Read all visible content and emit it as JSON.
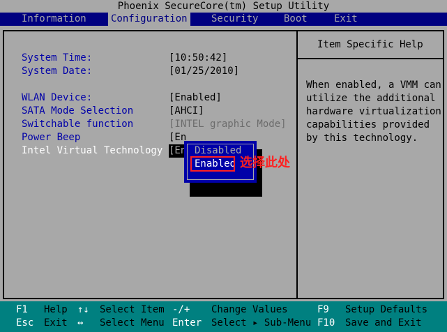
{
  "window": {
    "title": "Phoenix SecureCore(tm) Setup Utility"
  },
  "menu": {
    "items": [
      "Information",
      "Configuration",
      "Security",
      "Boot",
      "Exit"
    ],
    "active": "Configuration"
  },
  "settings": {
    "system_time": {
      "label": "System Time:",
      "value": "[10:50:42]"
    },
    "system_date": {
      "label": "System Date:",
      "value": "[01/25/2010]"
    },
    "wlan_device": {
      "label": "WLAN Device:",
      "value": "[Enabled]"
    },
    "sata_mode": {
      "label": "SATA Mode Selection",
      "value": "[AHCI]"
    },
    "switchable": {
      "label": "Switchable function",
      "value": "[INTEL graphic Mode]"
    },
    "power_beep": {
      "label": "Power Beep",
      "value": "[En"
    },
    "intel_vt": {
      "label": "Intel Virtual Technology",
      "value": "[En"
    }
  },
  "help_panel": {
    "title": "Item Specific Help",
    "lines": [
      "When enabled, a VMM can",
      "utilize the additional",
      "hardware virtualization",
      "capabilities provided",
      "by this technology."
    ]
  },
  "popup": {
    "options": [
      "Disabled",
      "Enabled"
    ],
    "selected": "Enabled"
  },
  "annotation": {
    "text": "选择此处"
  },
  "footer": {
    "row1": [
      {
        "key": "F1",
        "desc": "Help"
      },
      {
        "key": "↑↓",
        "desc": "Select Item"
      },
      {
        "key": "-/+",
        "desc": "Change Values"
      },
      {
        "key": "F9",
        "desc": "Setup Defaults"
      }
    ],
    "row2": [
      {
        "key": "Esc",
        "desc": "Exit"
      },
      {
        "key": "↔",
        "desc": "Select Menu"
      },
      {
        "key": "Enter",
        "desc": "Select ▸ Sub-Menu"
      },
      {
        "key": "F10",
        "desc": "Save and Exit"
      }
    ]
  },
  "colors": {
    "menu_bg": "#000080",
    "panel_bg": "#a8a8a8",
    "label_blue": "#0000a8",
    "footer_bg": "#008080",
    "annotation_red": "#ff2020"
  }
}
